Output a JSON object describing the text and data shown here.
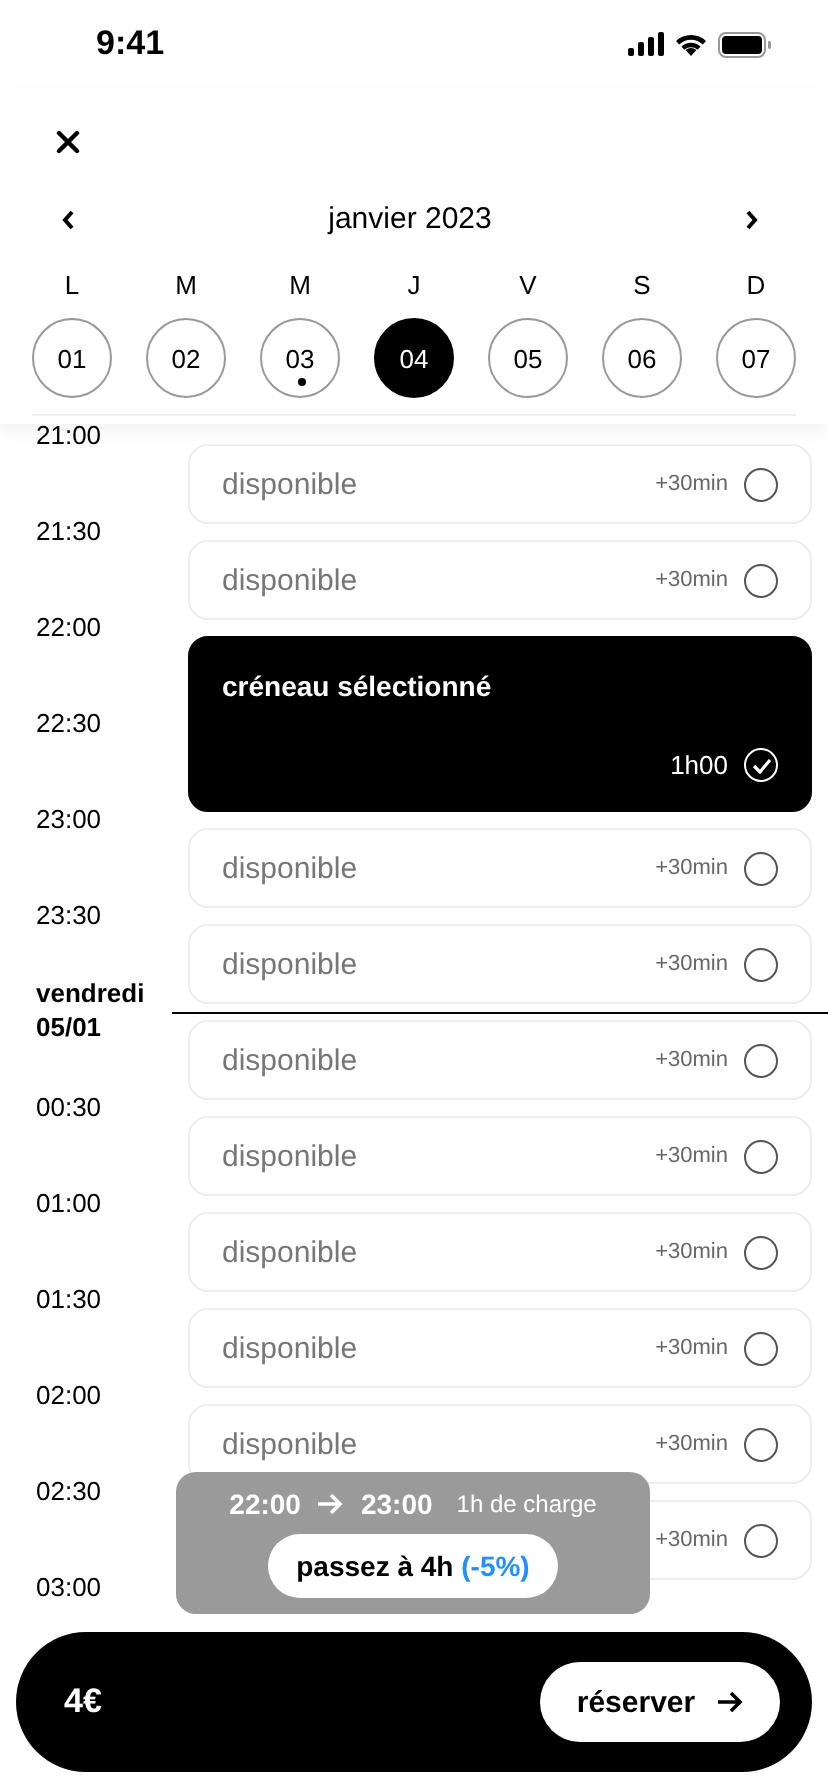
{
  "status_bar": {
    "time": "9:41"
  },
  "calendar": {
    "month": "janvier 2023",
    "days": [
      {
        "weekday": "L",
        "day": "01",
        "selected": false,
        "marked": false
      },
      {
        "weekday": "M",
        "day": "02",
        "selected": false,
        "marked": false
      },
      {
        "weekday": "M",
        "day": "03",
        "selected": false,
        "marked": true
      },
      {
        "weekday": "J",
        "day": "04",
        "selected": true,
        "marked": false
      },
      {
        "weekday": "V",
        "day": "05",
        "selected": false,
        "marked": false
      },
      {
        "weekday": "S",
        "day": "06",
        "selected": false,
        "marked": false
      },
      {
        "weekday": "D",
        "day": "07",
        "selected": false,
        "marked": false
      }
    ]
  },
  "times": [
    {
      "kind": "time",
      "label": "21:00"
    },
    {
      "kind": "time",
      "label": "21:30"
    },
    {
      "kind": "time",
      "label": "22:00"
    },
    {
      "kind": "time",
      "label": "22:30"
    },
    {
      "kind": "time",
      "label": "23:00"
    },
    {
      "kind": "time",
      "label": "23:30"
    },
    {
      "kind": "day",
      "label": "vendredi 05/01"
    },
    {
      "kind": "time",
      "label": "00:30"
    },
    {
      "kind": "time",
      "label": "01:00"
    },
    {
      "kind": "time",
      "label": "01:30"
    },
    {
      "kind": "time",
      "label": "02:00"
    },
    {
      "kind": "time",
      "label": "02:30"
    },
    {
      "kind": "time",
      "label": "03:00"
    }
  ],
  "slots": [
    {
      "kind": "available",
      "label": "disponible",
      "duration": "+30min",
      "checked": false
    },
    {
      "kind": "available",
      "label": "disponible",
      "duration": "+30min",
      "checked": false
    },
    {
      "kind": "selected",
      "label": "créneau sélectionné",
      "duration": "1h00",
      "checked": true
    },
    {
      "kind": "available",
      "label": "disponible",
      "duration": "+30min",
      "checked": false
    },
    {
      "kind": "available",
      "label": "disponible",
      "duration": "+30min",
      "checked": false
    },
    {
      "kind": "divider"
    },
    {
      "kind": "available",
      "label": "disponible",
      "duration": "+30min",
      "checked": false
    },
    {
      "kind": "available",
      "label": "disponible",
      "duration": "+30min",
      "checked": false
    },
    {
      "kind": "available",
      "label": "disponible",
      "duration": "+30min",
      "checked": false
    },
    {
      "kind": "available",
      "label": "disponible",
      "duration": "+30min",
      "checked": false
    },
    {
      "kind": "available",
      "label": "disponible",
      "duration": "+30min",
      "checked": false
    },
    {
      "kind": "available",
      "duration": "+30min",
      "checked": false
    }
  ],
  "summary": {
    "start": "22:00",
    "end": "23:00",
    "charge": "1h de charge",
    "upsell": "passez à 4h",
    "discount": "(-5%)"
  },
  "footer": {
    "price": "4€",
    "button": "réserver"
  }
}
